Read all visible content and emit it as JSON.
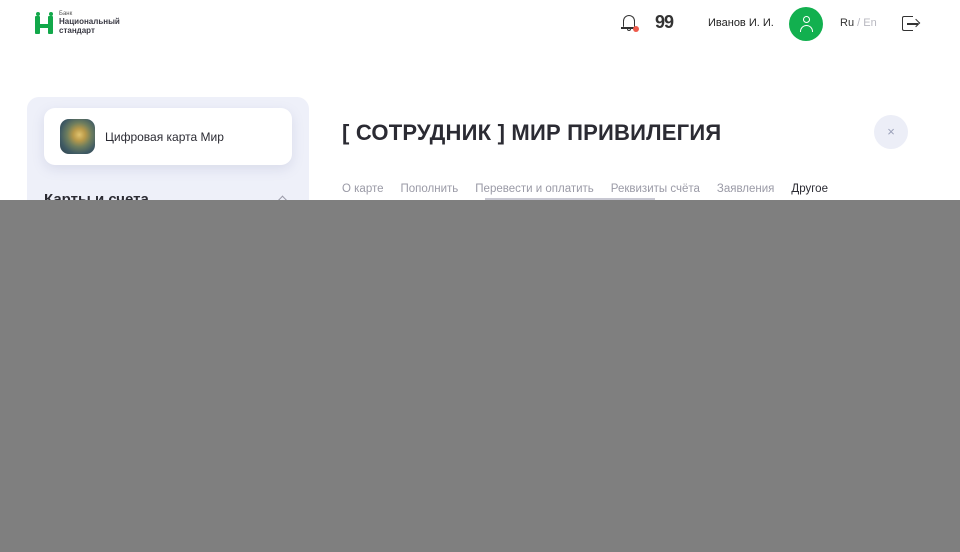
{
  "header": {
    "logo": {
      "small": "Банк",
      "line1": "Национальный",
      "line2": "стандарт",
      "color": "#12a84a"
    },
    "notification_icon": "bell-icon",
    "quote_icon": "quote-icon",
    "user_name": "Иванов И. И.",
    "avatar_color": "#12b04f",
    "lang": {
      "ru": "Ru",
      "sep": "/",
      "en": "En"
    },
    "logout_icon": "logout-icon"
  },
  "sidebar": {
    "card": {
      "title": "Цифровая карта Мир"
    },
    "section_title": "Карты и счета"
  },
  "main": {
    "title": "[ СОТРУДНИК ] МИР ПРИВИЛЕГИЯ",
    "close_label": "×",
    "tabs": [
      {
        "label": "О карте",
        "active": false
      },
      {
        "label": "Пополнить",
        "active": false
      },
      {
        "label": "Перевести и оплатить",
        "active": false
      },
      {
        "label": "Реквизиты счёта",
        "active": false
      },
      {
        "label": "Заявления",
        "active": false
      },
      {
        "label": "Другое",
        "active": true
      }
    ]
  },
  "overlay_color": "#7f7f7f"
}
